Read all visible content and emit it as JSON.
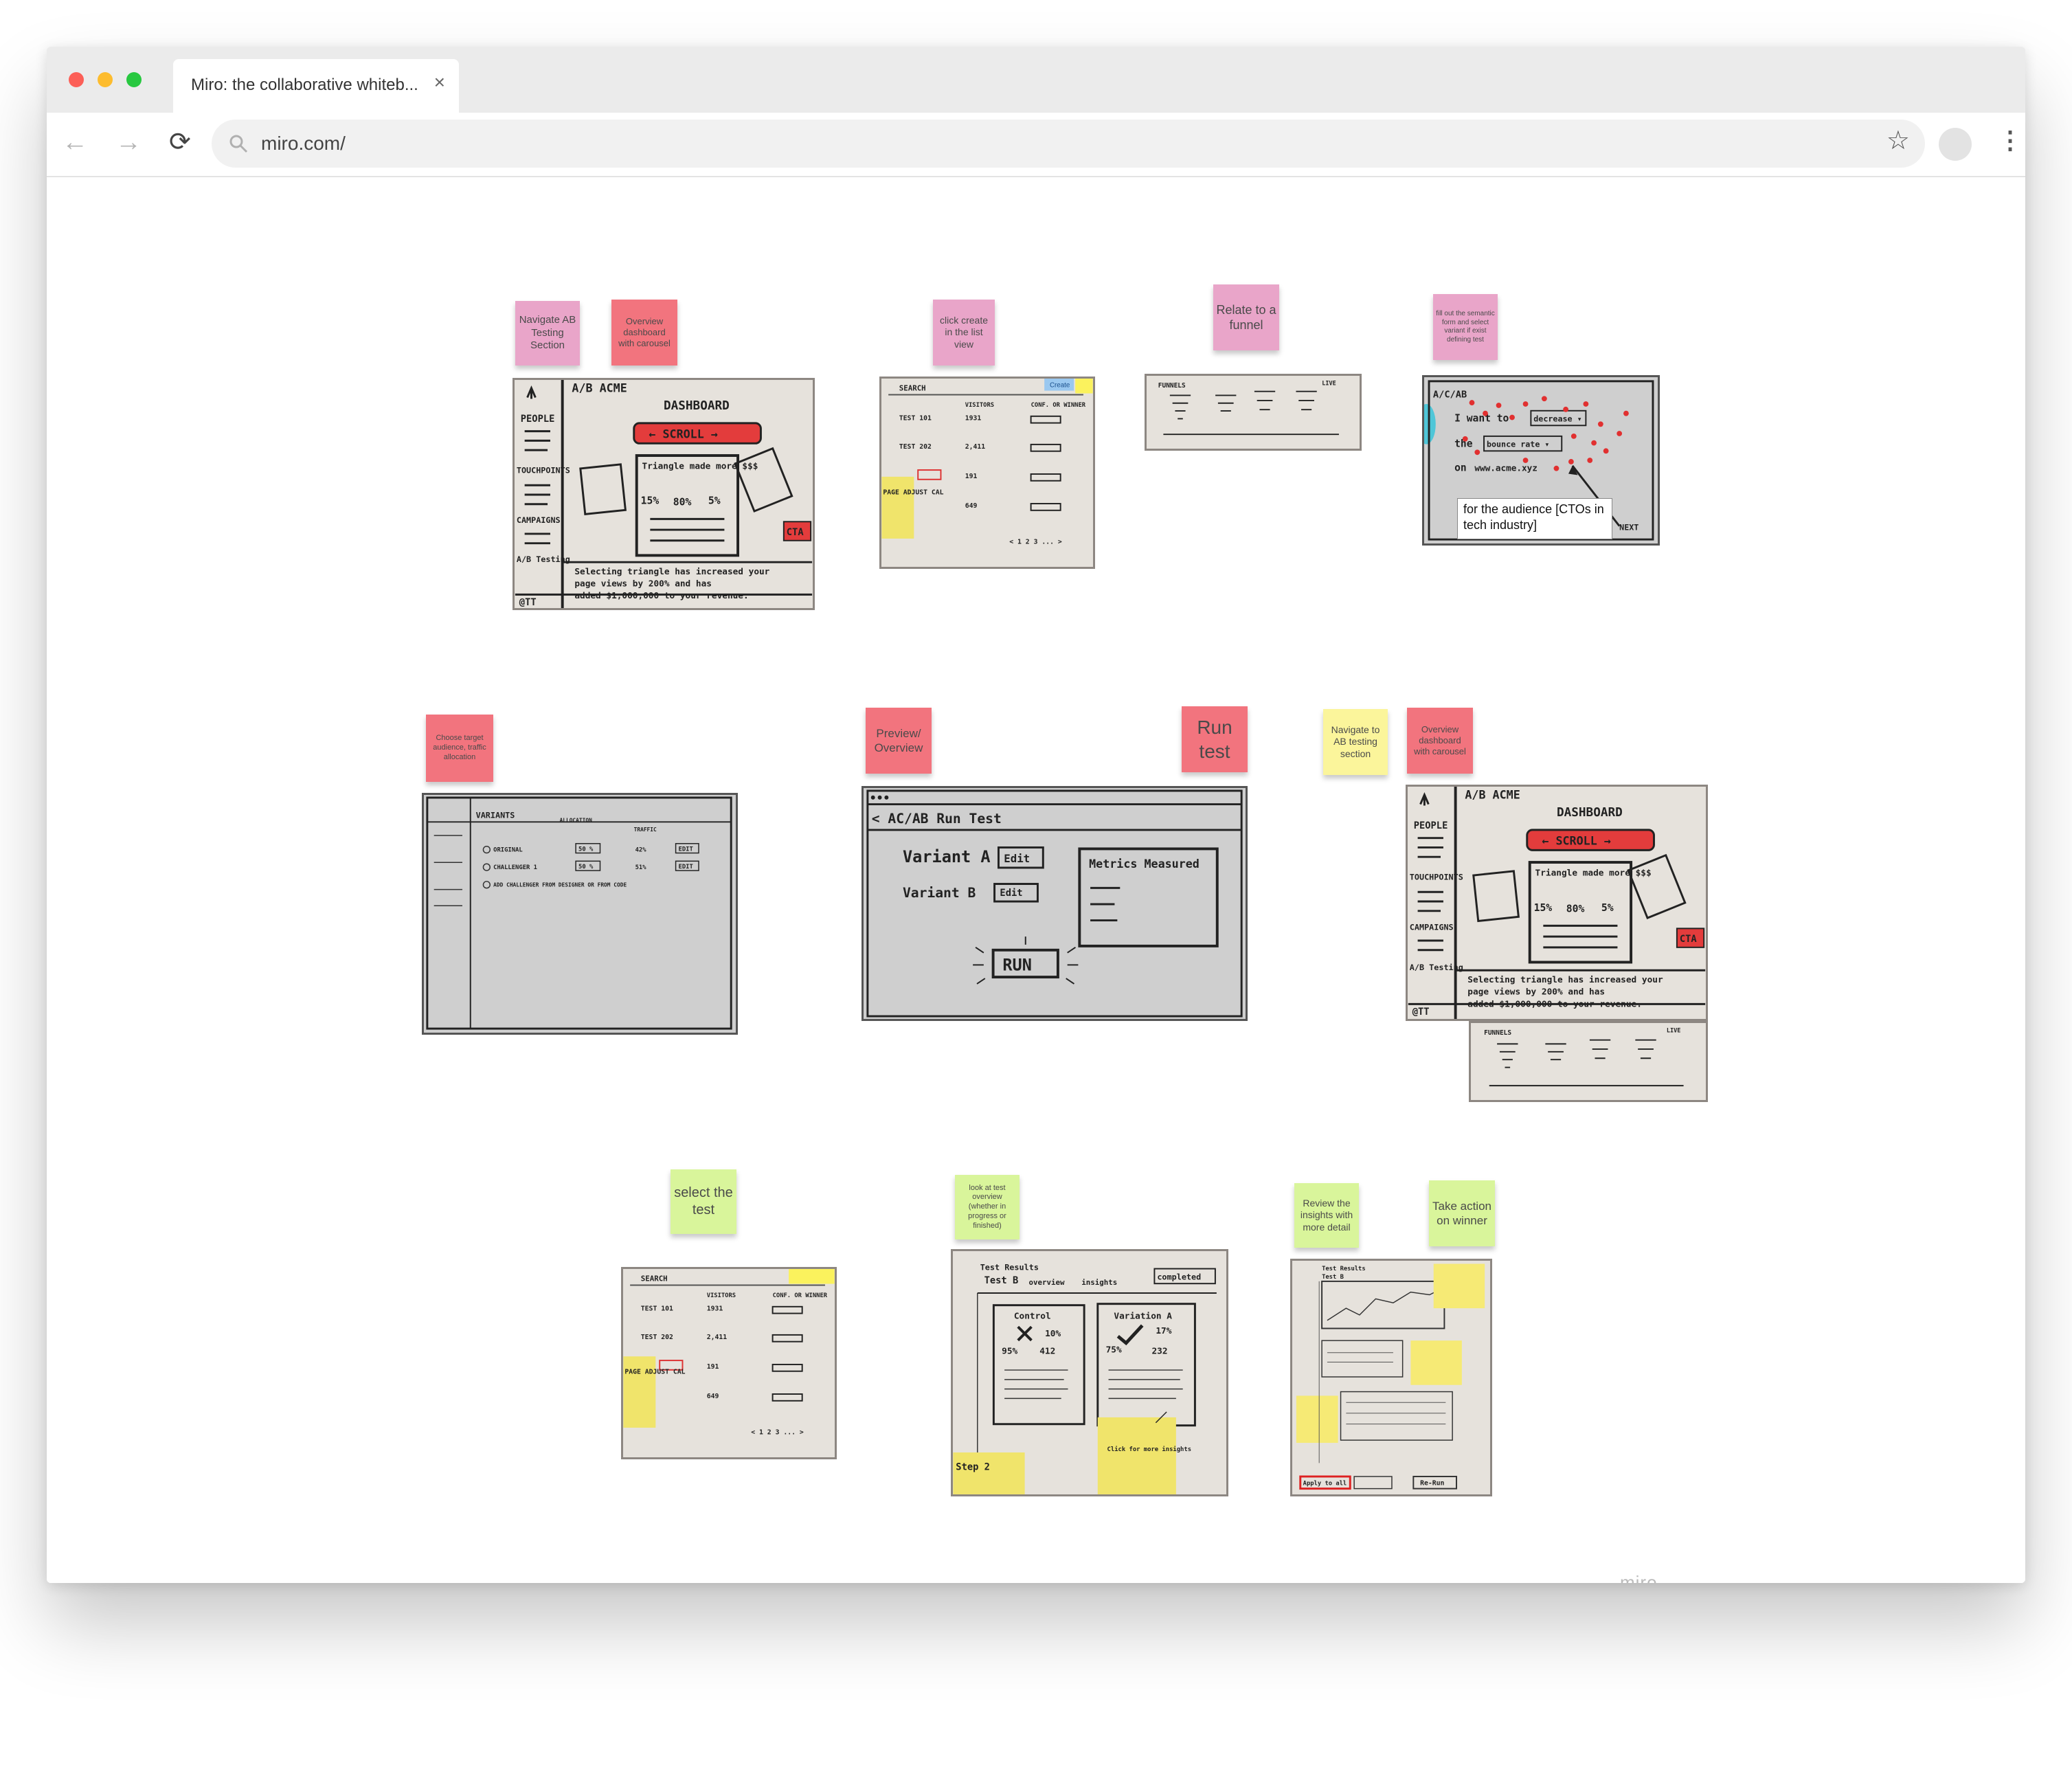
{
  "browser": {
    "tab_title": "Miro: the collaborative whiteb...",
    "close_label": "×",
    "url": "miro.com/",
    "nav": {
      "back": "←",
      "forward": "→",
      "reload": "⟳",
      "star": "☆",
      "menu": "⋮"
    }
  },
  "board": {
    "brand": "miro",
    "stickies": {
      "navigate_ab": "Navigate AB Testing Section",
      "overview_carousel": "Overview dashboard with carousel",
      "click_create": "click create in the list view",
      "relate_funnel": "Relate to a funnel",
      "fill_form": "fill out the semantic form and select variant if exist defining test",
      "choose_target": "Choose target audience, traffic allocation",
      "preview": "Preview/ Overview",
      "run_test": "Run test",
      "navigate_ab_2": "Navigate to AB testing section",
      "overview_carousel_2": "Overview dashboard with carousel",
      "select_test": "select the test",
      "look_at_test": "look at test overview (whether in progress or finished)",
      "review_insights": "Review the insights with more detail",
      "take_action": "Take action on winner"
    },
    "callout_audience": "for the audience [CTOs in tech industry]",
    "sketches": {
      "dashboard": {
        "logo": "A/B ACME",
        "title": "DASHBOARD",
        "scroll": "← SCROLL →",
        "nav": [
          "PEOPLE",
          "TOUCHPOINTS",
          "CAMPAIGNS",
          "A/B Testing"
        ],
        "metric_title": "Triangle made more $$$",
        "metrics": [
          "15%",
          "80%",
          "5%"
        ],
        "cta": "CTA",
        "copy_1": "Selecting triangle has increased your",
        "copy_2": "page views by 200% and has",
        "copy_3": "added $1,000,000 to your revenue.",
        "user": "@TT"
      },
      "list": {
        "search": "SEARCH",
        "create": "Create",
        "columns": [
          "VISITORS",
          "CONF. OR WINNER"
        ],
        "rows": [
          {
            "name": "TEST 101",
            "visitors": "1931"
          },
          {
            "name": "TEST 202",
            "visitors": "2,411"
          },
          {
            "name": "",
            "visitors": "191"
          },
          {
            "name": "",
            "visitors": "649"
          }
        ],
        "side_note": "PAGE ADJUST CAL",
        "pager": "< 1 2 3 ... >"
      },
      "funnel": {
        "title": "FUNNELS",
        "tag": "LIVE"
      },
      "form": {
        "header": "A/C/AB",
        "line1_prefix": "I want to",
        "line1_choice": "decrease ▾",
        "line2_prefix": "the",
        "line2_choice": "bounce rate ▾",
        "line3_prefix": "on",
        "line3_value": "www.acme.xyz",
        "next": "NEXT"
      },
      "variants": {
        "title": "VARIANTS",
        "allocation_header": "ALLOCATION",
        "traffic_header": "TRAFFIC",
        "rows": [
          {
            "name": "ORIGINAL",
            "alloc": "50 %",
            "traffic": "42%",
            "action": "EDIT"
          },
          {
            "name": "CHALLENGER 1",
            "alloc": "50 %",
            "traffic": "51%",
            "action": "EDIT"
          }
        ],
        "add": "ADD CHALLENGER FROM DESIGNER OR FROM CODE"
      },
      "run": {
        "header": "< AC/AB   Run Test",
        "variant_a": "Variant A",
        "variant_b": "Variant B",
        "edit": "Edit",
        "metrics": "Metrics Measured",
        "run": "RUN"
      },
      "results": {
        "header": "Test Results",
        "test": "Test B",
        "tabs": [
          "overview",
          "insights"
        ],
        "status": "completed",
        "control": "Control",
        "variation": "Variation A",
        "control_conf": "10%",
        "control_stats": [
          "95%",
          "412"
        ],
        "variation_conf": "17%",
        "variation_stats": [
          "75%",
          "232"
        ],
        "step": "Step 2",
        "note": "Click for more insights"
      },
      "insights": {
        "title": "Test Results",
        "test": "Test B",
        "apply": "Apply to all",
        "rerun": "Re-Run"
      }
    }
  }
}
